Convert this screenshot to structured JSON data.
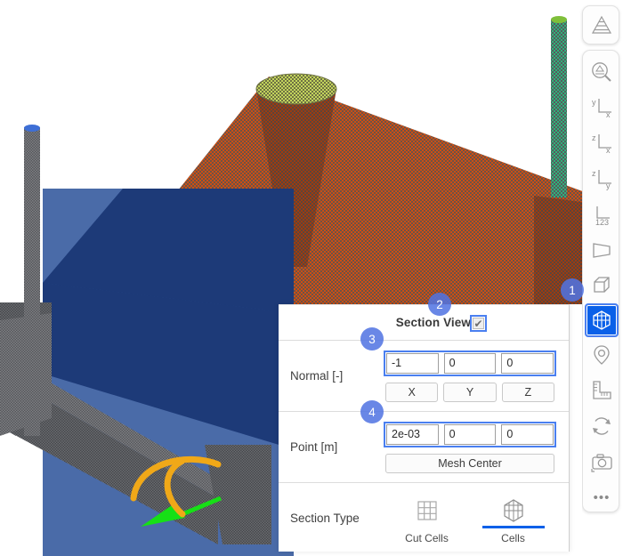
{
  "app": {
    "viewport_name": "3d-mesh-viewport"
  },
  "panel": {
    "section_view_label": "Section View",
    "section_view_checked": true,
    "checkmark_glyph": "✔",
    "normal": {
      "label": "Normal [-]",
      "values": [
        "-1",
        "0",
        "0"
      ],
      "axis_buttons": [
        "X",
        "Y",
        "Z"
      ]
    },
    "point": {
      "label": "Point [m]",
      "values": [
        "2e-03",
        "0",
        "0"
      ],
      "center_button": "Mesh Center"
    },
    "section_type": {
      "label": "Section Type",
      "options": [
        {
          "label": "Cut Cells",
          "icon": "grid-3x3-icon",
          "selected": false
        },
        {
          "label": "Cells",
          "icon": "mesh-cube-icon",
          "selected": true
        }
      ]
    }
  },
  "badges": [
    {
      "number": "1",
      "target": "toolbar-section-view-button"
    },
    {
      "number": "2",
      "target": "section-view-checkbox"
    },
    {
      "number": "3",
      "target": "normal-inputs"
    },
    {
      "number": "4",
      "target": "point-inputs"
    }
  ],
  "toolbar": {
    "top": [
      {
        "name": "layers-pyramid-icon",
        "tooltip": "Scene"
      }
    ],
    "items": [
      {
        "name": "zoom-fit-icon",
        "tooltip": "Fit view"
      },
      {
        "name": "view-yx-icon",
        "labels": [
          "y",
          "x"
        ]
      },
      {
        "name": "view-zx-icon",
        "labels": [
          "z",
          "x"
        ]
      },
      {
        "name": "view-zy-icon",
        "labels": [
          "z",
          "y"
        ]
      },
      {
        "name": "view-123-icon",
        "labels": [
          "123"
        ]
      },
      {
        "name": "perspective-icon"
      },
      {
        "name": "box-outline-icon"
      },
      {
        "name": "mesh-cube-icon",
        "active": true
      },
      {
        "name": "location-pin-icon"
      },
      {
        "name": "ruler-icon"
      },
      {
        "name": "refresh-icon"
      },
      {
        "name": "camera-icon"
      },
      {
        "name": "more-options-icon",
        "glyph": "•••"
      }
    ]
  },
  "colors": {
    "accent_blue": "#0a60e8",
    "badge_blue": "#5073e2",
    "focus_ring": "#4a7ff0",
    "mesh_orange": "#cc4f14",
    "mesh_green": "#b5c94a",
    "cyl_green": "#2fb37a",
    "plane_blue_front": "#4a6ba8",
    "plane_blue_cut": "#1d3a78",
    "beam_gray": "#55565a",
    "arrow_green": "#16e016",
    "arc_orange": "#f0a818"
  }
}
